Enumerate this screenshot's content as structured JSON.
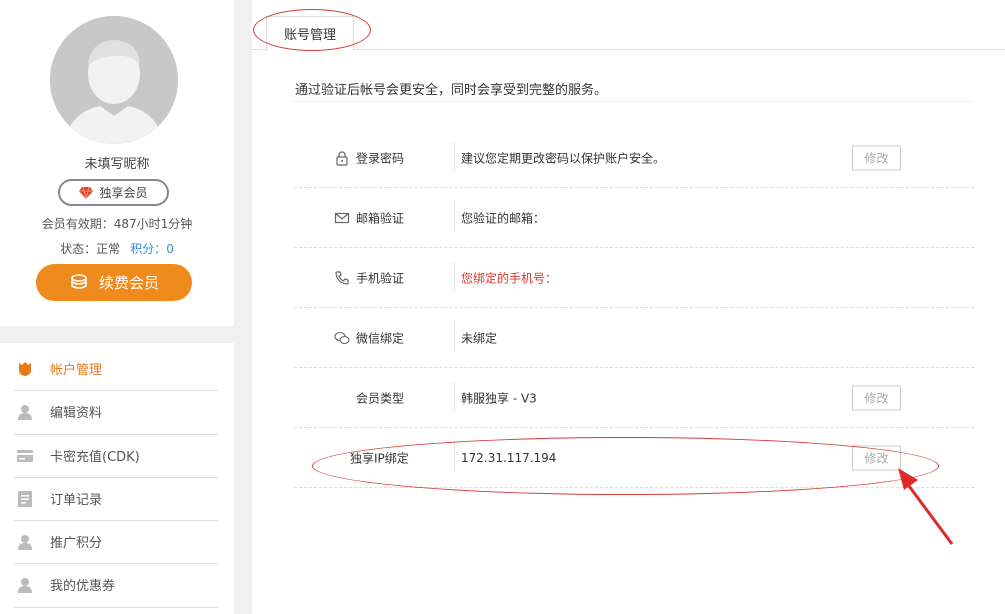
{
  "profile": {
    "nickname": "未填写昵称",
    "badge_label": "独享会员",
    "expire_text": "会员有效期：487小时1分钟",
    "status_text": "状态：正常",
    "points_text": "积分：0",
    "renew_label": "续费会员"
  },
  "menu": {
    "items": [
      {
        "label": "帐户管理",
        "icon": "shield-icon"
      },
      {
        "label": "编辑资料",
        "icon": "user-icon"
      },
      {
        "label": "卡密充值(CDK)",
        "icon": "card-icon"
      },
      {
        "label": "订单记录",
        "icon": "document-icon"
      },
      {
        "label": "推广积分",
        "icon": "user-icon"
      },
      {
        "label": "我的优惠券",
        "icon": "user-icon"
      }
    ]
  },
  "main": {
    "tab_label": "账号管理",
    "intro": "通过验证后帐号会更安全，同时会享受到完整的服务。",
    "rows": [
      {
        "label": "登录密码",
        "value": "建议您定期更改密码以保护账户安全。",
        "button": "修改",
        "icon": "lock-icon"
      },
      {
        "label": "邮箱验证",
        "value": "您验证的邮箱：",
        "icon": "mail-icon"
      },
      {
        "label": "手机验证",
        "value": "您绑定的手机号：",
        "icon": "phone-icon"
      },
      {
        "label": "微信绑定",
        "value": "未绑定",
        "icon": "wechat-icon"
      },
      {
        "label": "会员类型",
        "value": "韩服独享 - V3",
        "button": "修改"
      },
      {
        "label": "独享IP绑定",
        "value": "172.31.117.194",
        "button": "修改"
      }
    ]
  },
  "colors": {
    "accent": "#ef8a1c",
    "menu_active": "#e87a1a",
    "link_blue": "#3a8ed8",
    "warn_red": "#d9342b",
    "annotation_red": "#d43a3a"
  }
}
